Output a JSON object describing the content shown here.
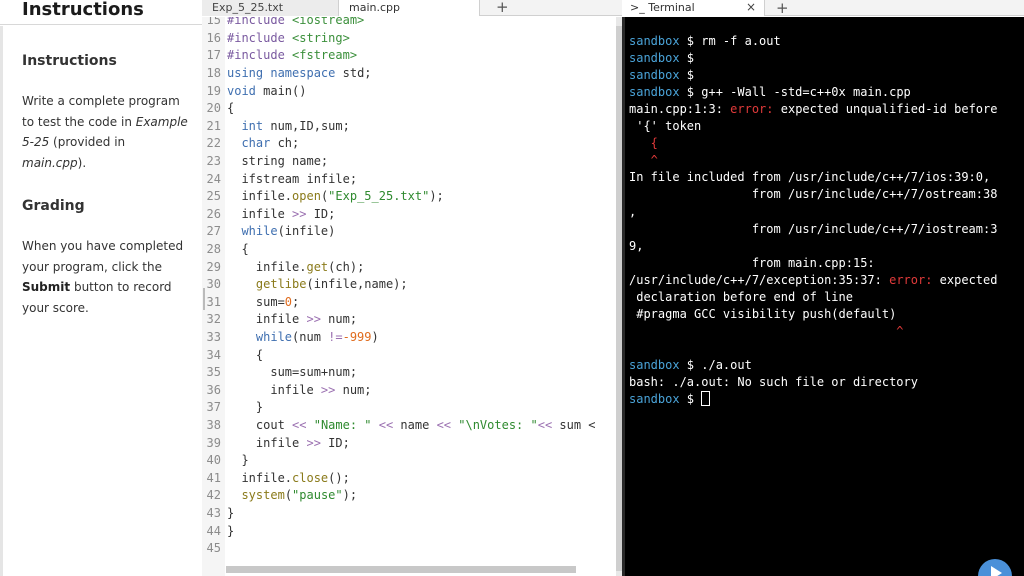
{
  "instructions": {
    "header": "Instructions",
    "section_title": "Instructions",
    "para1_a": "Write a complete program to test the code in ",
    "para1_em1": "Example 5-25",
    "para1_b": " (provided in ",
    "para1_em2": "main.cpp",
    "para1_c": ").",
    "grading_title": "Grading",
    "para2_a": "When you have completed your program, click the ",
    "para2_bold": "Submit",
    "para2_b": " button to record your score."
  },
  "editor": {
    "tabs": [
      "Exp_5_25.txt",
      "main.cpp"
    ],
    "add_tab_icon": "+",
    "lines": [
      {
        "n": "15",
        "code": "#include <iostream>"
      },
      {
        "n": "16",
        "code": "#include <string>"
      },
      {
        "n": "17",
        "code": "#include <fstream>"
      },
      {
        "n": "18",
        "code": "using namespace std;"
      },
      {
        "n": "19",
        "code": "void main()"
      },
      {
        "n": "20",
        "code": "{"
      },
      {
        "n": "21",
        "code": "  int num,ID,sum;"
      },
      {
        "n": "22",
        "code": "  char ch;"
      },
      {
        "n": "23",
        "code": "  string name;"
      },
      {
        "n": "24",
        "code": "  ifstream infile;"
      },
      {
        "n": "25",
        "code": "  infile.open(\"Exp_5_25.txt\");"
      },
      {
        "n": "26",
        "code": "  infile >> ID;"
      },
      {
        "n": "27",
        "code": "  while(infile)"
      },
      {
        "n": "28",
        "code": "  {"
      },
      {
        "n": "29",
        "code": "    infile.get(ch);"
      },
      {
        "n": "30",
        "code": "    getlibe(infile,name);"
      },
      {
        "n": "31",
        "code": "    sum=0;"
      },
      {
        "n": "32",
        "code": "    infile >> num;"
      },
      {
        "n": "33",
        "code": "    while(num !=-999)"
      },
      {
        "n": "34",
        "code": "    {"
      },
      {
        "n": "35",
        "code": "      sum=sum+num;"
      },
      {
        "n": "36",
        "code": "      infile >> num;"
      },
      {
        "n": "37",
        "code": "    }"
      },
      {
        "n": "38",
        "code": "    cout << \"Name: \" << name << \"\\nVotes: \"<< sum <"
      },
      {
        "n": "39",
        "code": "    infile >> ID;"
      },
      {
        "n": "40",
        "code": "  }"
      },
      {
        "n": "41",
        "code": "  infile.close();"
      },
      {
        "n": "42",
        "code": "  system(\"pause\");"
      },
      {
        "n": "43",
        "code": "}"
      },
      {
        "n": "44",
        "code": "}"
      },
      {
        "n": "45",
        "code": ""
      }
    ]
  },
  "terminal": {
    "tab_label": "Terminal",
    "tab_icon": ">_",
    "close_icon": "×",
    "add_icon": "+",
    "prompt": "sandbox",
    "lines": [
      {
        "p": "sandbox",
        "t": " $ rm -f a.out"
      },
      {
        "p": "sandbox",
        "t": " $"
      },
      {
        "p": "sandbox",
        "t": " $"
      },
      {
        "p": "sandbox",
        "t": " $ g++ -Wall -std=c++0x main.cpp"
      },
      {
        "p": "",
        "t": "main.cpp:1:3: ",
        "e": "error:",
        "t2": " expected unqualified-id before"
      },
      {
        "p": "",
        "t": " '{' token"
      },
      {
        "p": "",
        "t": "",
        "e": "   {"
      },
      {
        "p": "",
        "t": "",
        "e": "   ^"
      },
      {
        "p": "",
        "t": "In file included from /usr/include/c++/7/ios:39:0,"
      },
      {
        "p": "",
        "t": "                 from /usr/include/c++/7/ostream:38"
      },
      {
        "p": "",
        "t": ","
      },
      {
        "p": "",
        "t": "                 from /usr/include/c++/7/iostream:3"
      },
      {
        "p": "",
        "t": "9,"
      },
      {
        "p": "",
        "t": "                 from main.cpp:15:"
      },
      {
        "p": "",
        "t": "/usr/include/c++/7/exception:35:37: ",
        "e": "error:",
        "t2": " expected"
      },
      {
        "p": "",
        "t": " declaration before end of line"
      },
      {
        "p": "",
        "t": " #pragma GCC visibility push(default)"
      },
      {
        "p": "",
        "t": "",
        "e": "                                     ^"
      },
      {
        "p": "",
        "t": ""
      },
      {
        "p": "sandbox",
        "t": " $ ./a.out"
      },
      {
        "p": "",
        "t": "bash: ./a.out: No such file or directory"
      },
      {
        "p": "sandbox",
        "t": " $ ",
        "cursor": true
      }
    ]
  }
}
